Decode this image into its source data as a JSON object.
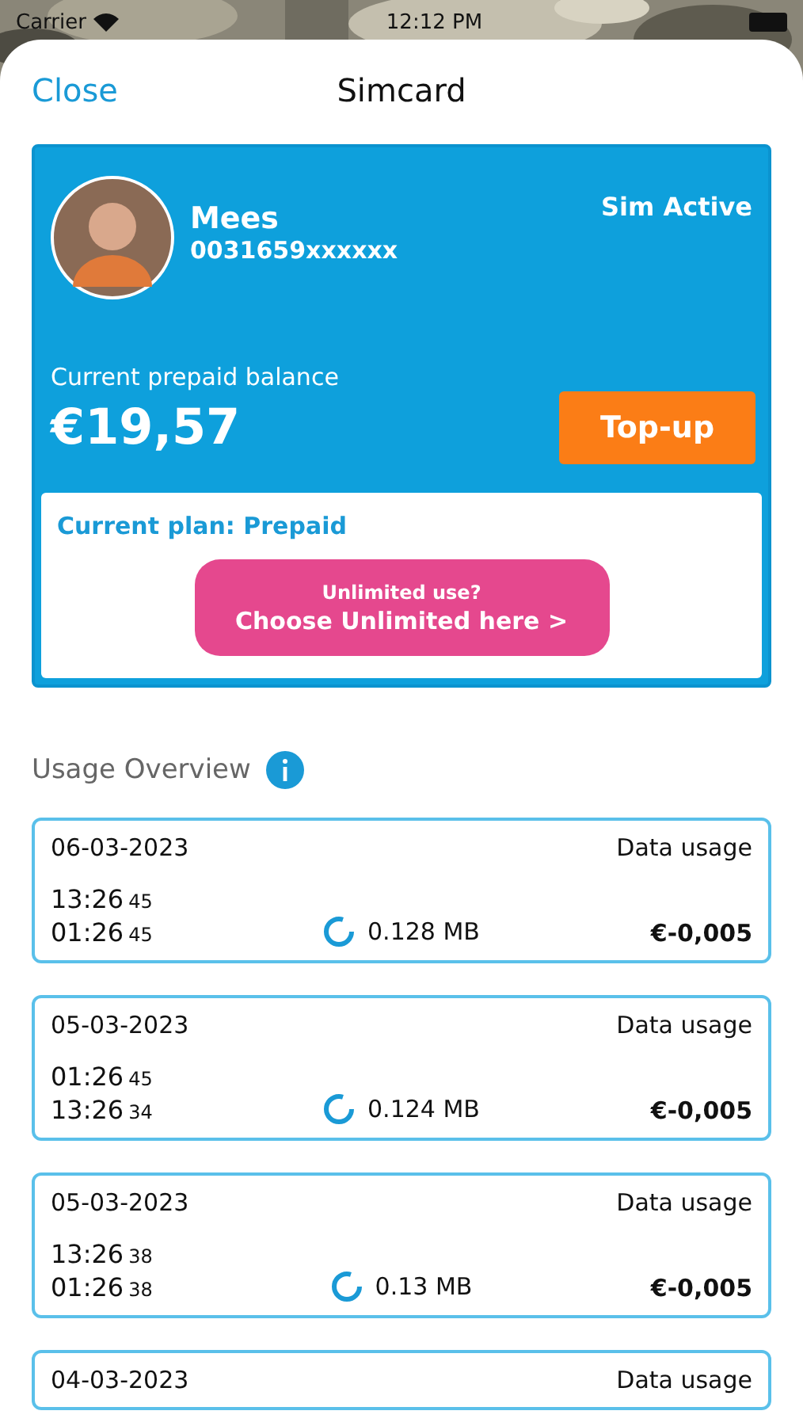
{
  "status_bar": {
    "carrier": "Carrier",
    "time": "12:12 PM"
  },
  "nav": {
    "close": "Close",
    "title": "Simcard"
  },
  "sim_card": {
    "name": "Mees",
    "number": "0031659xxxxxx",
    "status": "Sim Active",
    "balance_label": "Current prepaid balance",
    "balance": "€19,57",
    "topup": "Top-up",
    "plan_label": "Current plan:",
    "plan": "Prepaid",
    "promo_line1": "Unlimited use?",
    "promo_line2": "Choose Unlimited here >"
  },
  "usage": {
    "title": "Usage Overview",
    "items": [
      {
        "date": "06-03-2023",
        "type": "Data usage",
        "times": [
          {
            "hm": "13:26",
            "sec": "45"
          },
          {
            "hm": "01:26",
            "sec": "45"
          }
        ],
        "amount": "0.128 MB",
        "cost": "€-0,005"
      },
      {
        "date": "05-03-2023",
        "type": "Data usage",
        "times": [
          {
            "hm": "01:26",
            "sec": "45"
          },
          {
            "hm": "13:26",
            "sec": "34"
          }
        ],
        "amount": "0.124 MB",
        "cost": "€-0,005"
      },
      {
        "date": "05-03-2023",
        "type": "Data usage",
        "times": [
          {
            "hm": "13:26",
            "sec": "38"
          },
          {
            "hm": "01:26",
            "sec": "38"
          }
        ],
        "amount": "0.13 MB",
        "cost": "€-0,005"
      },
      {
        "date": "04-03-2023",
        "type": "Data usage"
      }
    ]
  }
}
